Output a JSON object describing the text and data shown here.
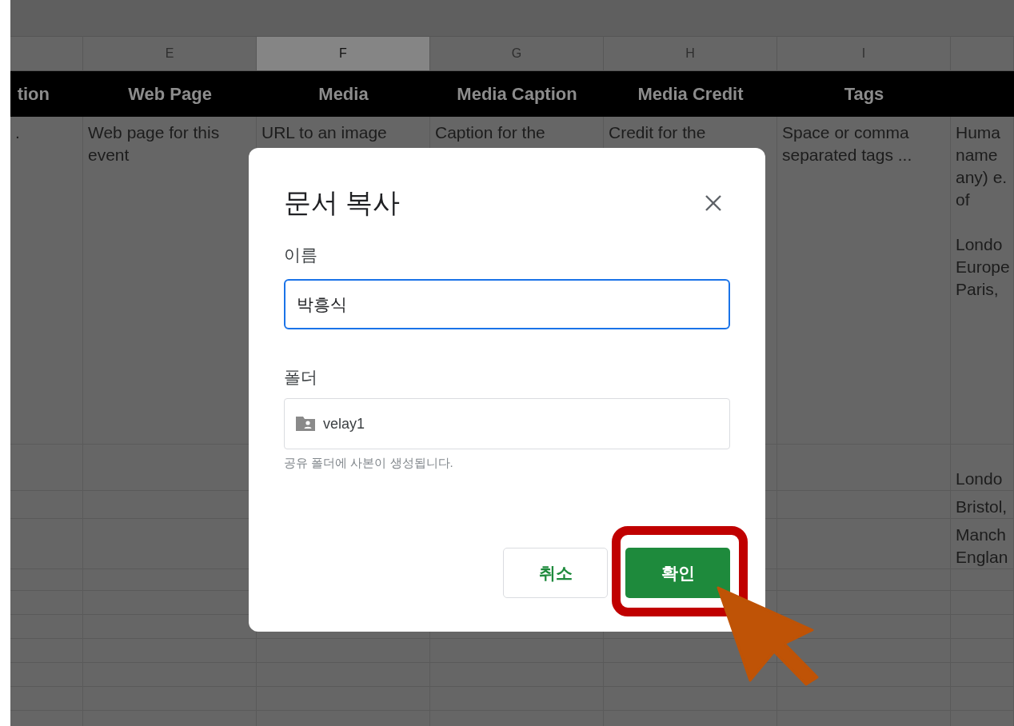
{
  "sheet": {
    "columns": [
      {
        "selected": false,
        "header": "tion"
      },
      {
        "letter": "E",
        "selected": false,
        "header": "Web Page"
      },
      {
        "letter": "F",
        "selected": true,
        "header": "Media"
      },
      {
        "letter": "G",
        "selected": false,
        "header": "Media Caption"
      },
      {
        "letter": "H",
        "selected": false,
        "header": "Media Credit"
      },
      {
        "letter": "I",
        "selected": false,
        "header": "Tags"
      },
      {
        "selected": false
      }
    ],
    "rows": [
      {
        "cells": [
          ".",
          "Web page for this event",
          "URL to an image",
          "Caption for the",
          "Credit for the",
          "Space or comma separated tags ...",
          "Huma\nname\nany) e.\nof\n\nLondo\nEurope\nParis,"
        ]
      },
      {
        "cells": [
          null,
          null,
          null,
          null,
          null,
          null,
          "Londo"
        ]
      },
      {
        "cells": [
          null,
          null,
          null,
          null,
          null,
          null,
          "Bristol,"
        ]
      },
      {
        "cells": [
          null,
          null,
          null,
          null,
          null,
          null,
          "Manch\nEnglan"
        ]
      }
    ]
  },
  "dialog": {
    "title": "문서 복사",
    "name_label": "이름",
    "name_value": "박흥식",
    "folder_label": "폴더",
    "folder_value": "velay1",
    "hint": "공유 폴더에 사본이 생성됩니다.",
    "buttons": [
      {
        "label": "취소",
        "kind": "secondary"
      },
      {
        "label": "확인",
        "kind": "primary",
        "highlighted": true
      }
    ]
  }
}
